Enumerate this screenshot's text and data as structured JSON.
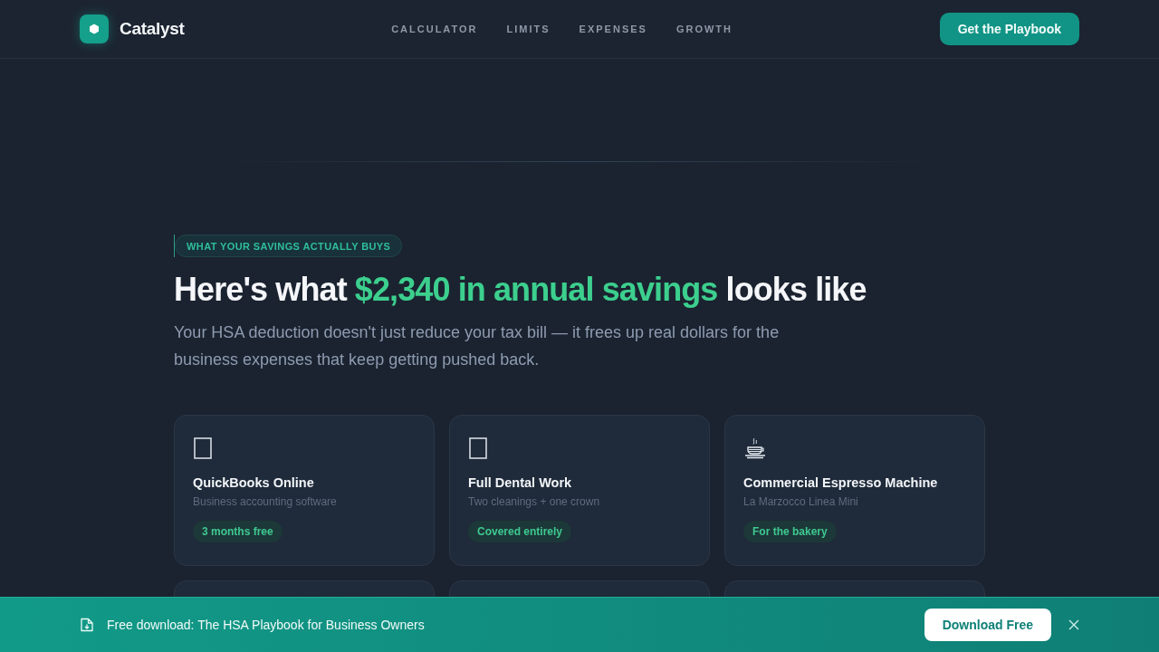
{
  "header": {
    "brand": "Catalyst",
    "nav": [
      {
        "label": "CALCULATOR"
      },
      {
        "label": "LIMITS"
      },
      {
        "label": "EXPENSES"
      },
      {
        "label": "GROWTH"
      }
    ],
    "cta": "Get the Playbook"
  },
  "section": {
    "eyebrow": "WHAT YOUR SAVINGS ACTUALLY BUYS",
    "heading": {
      "before": "Here's what ",
      "highlight": "$2,340 in annual savings",
      "after": " looks like"
    },
    "intro": "Your HSA deduction doesn't just reduce your tax bill — it frees up real dollars for the business expenses that keep getting pushed back."
  },
  "cards": [
    {
      "kind": "full",
      "title": "QuickBooks Online",
      "subtitle": "Business accounting software",
      "tag": "3 months free"
    },
    {
      "kind": "full",
      "title": "Full Dental Work",
      "subtitle": "Two cleanings + one crown",
      "tag": "Covered entirely"
    },
    {
      "kind": "full",
      "title": "Commercial Espresso Machine",
      "subtitle": "La Marzocco Linea Mini",
      "tag": "For the bakery"
    },
    {
      "kind": "cut"
    },
    {
      "kind": "cut"
    },
    {
      "kind": "cut"
    }
  ],
  "banner": {
    "text": "Free download: The HSA Playbook for Business Owners",
    "button": "Download Free"
  }
}
